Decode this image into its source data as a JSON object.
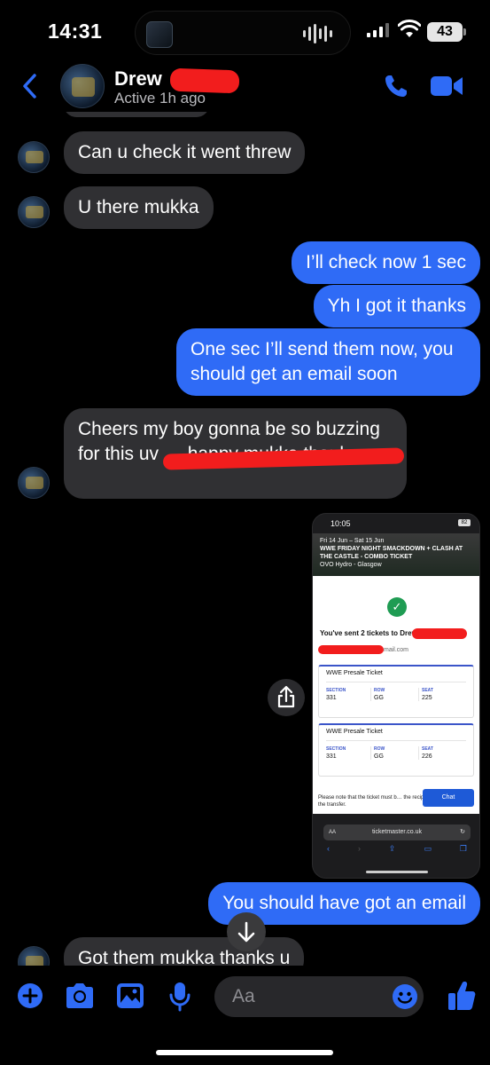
{
  "status_bar": {
    "time": "14:31",
    "battery": "43"
  },
  "header": {
    "contact_name": "Drew",
    "presence": "Active 1h ago"
  },
  "messages": [
    {
      "from": "them",
      "text": "Can u check it went threw"
    },
    {
      "from": "them",
      "text": "U there mukka"
    },
    {
      "from": "me",
      "text": "I’ll check now 1 sec"
    },
    {
      "from": "me",
      "text": "Yh I got it thanks"
    },
    {
      "from": "me",
      "text": "One sec I’ll send them now, you should get an email soon"
    },
    {
      "from": "them",
      "text": "Cheers my boy gonna be so buzzing for this uv … happy mukka thanks"
    },
    {
      "from": "me",
      "text": "You should have got an email"
    },
    {
      "from": "them",
      "text": "Got them mukka thanks u"
    }
  ],
  "attachment": {
    "time": "10:05",
    "battery": "82",
    "dates": "Fri 14 Jun – Sat 15 Jun",
    "event": "WWE FRIDAY NIGHT SMACKDOWN + CLASH AT THE CASTLE - COMBO TICKET",
    "venue": "OVO Hydro - Glasgow",
    "sent_text": "You've sent 2 tickets to Drew",
    "email_suffix": "mail.com",
    "tickets": [
      {
        "title": "WWE Presale Ticket",
        "section": "331",
        "row": "GG",
        "seat": "225"
      },
      {
        "title": "WWE Presale Ticket",
        "section": "331",
        "row": "GG",
        "seat": "226"
      }
    ],
    "labels": {
      "section": "SECTION",
      "row": "ROW",
      "seat": "SEAT"
    },
    "note": "Please note that the ticket must b… the recipient for completion of the transfer.",
    "chat_label": "Chat",
    "aa": "AA",
    "url": "ticketmaster.co.uk"
  },
  "composer": {
    "placeholder": "Aa"
  },
  "colors": {
    "accent": "#2f6bf6",
    "incoming": "#303033",
    "background": "#000000"
  }
}
